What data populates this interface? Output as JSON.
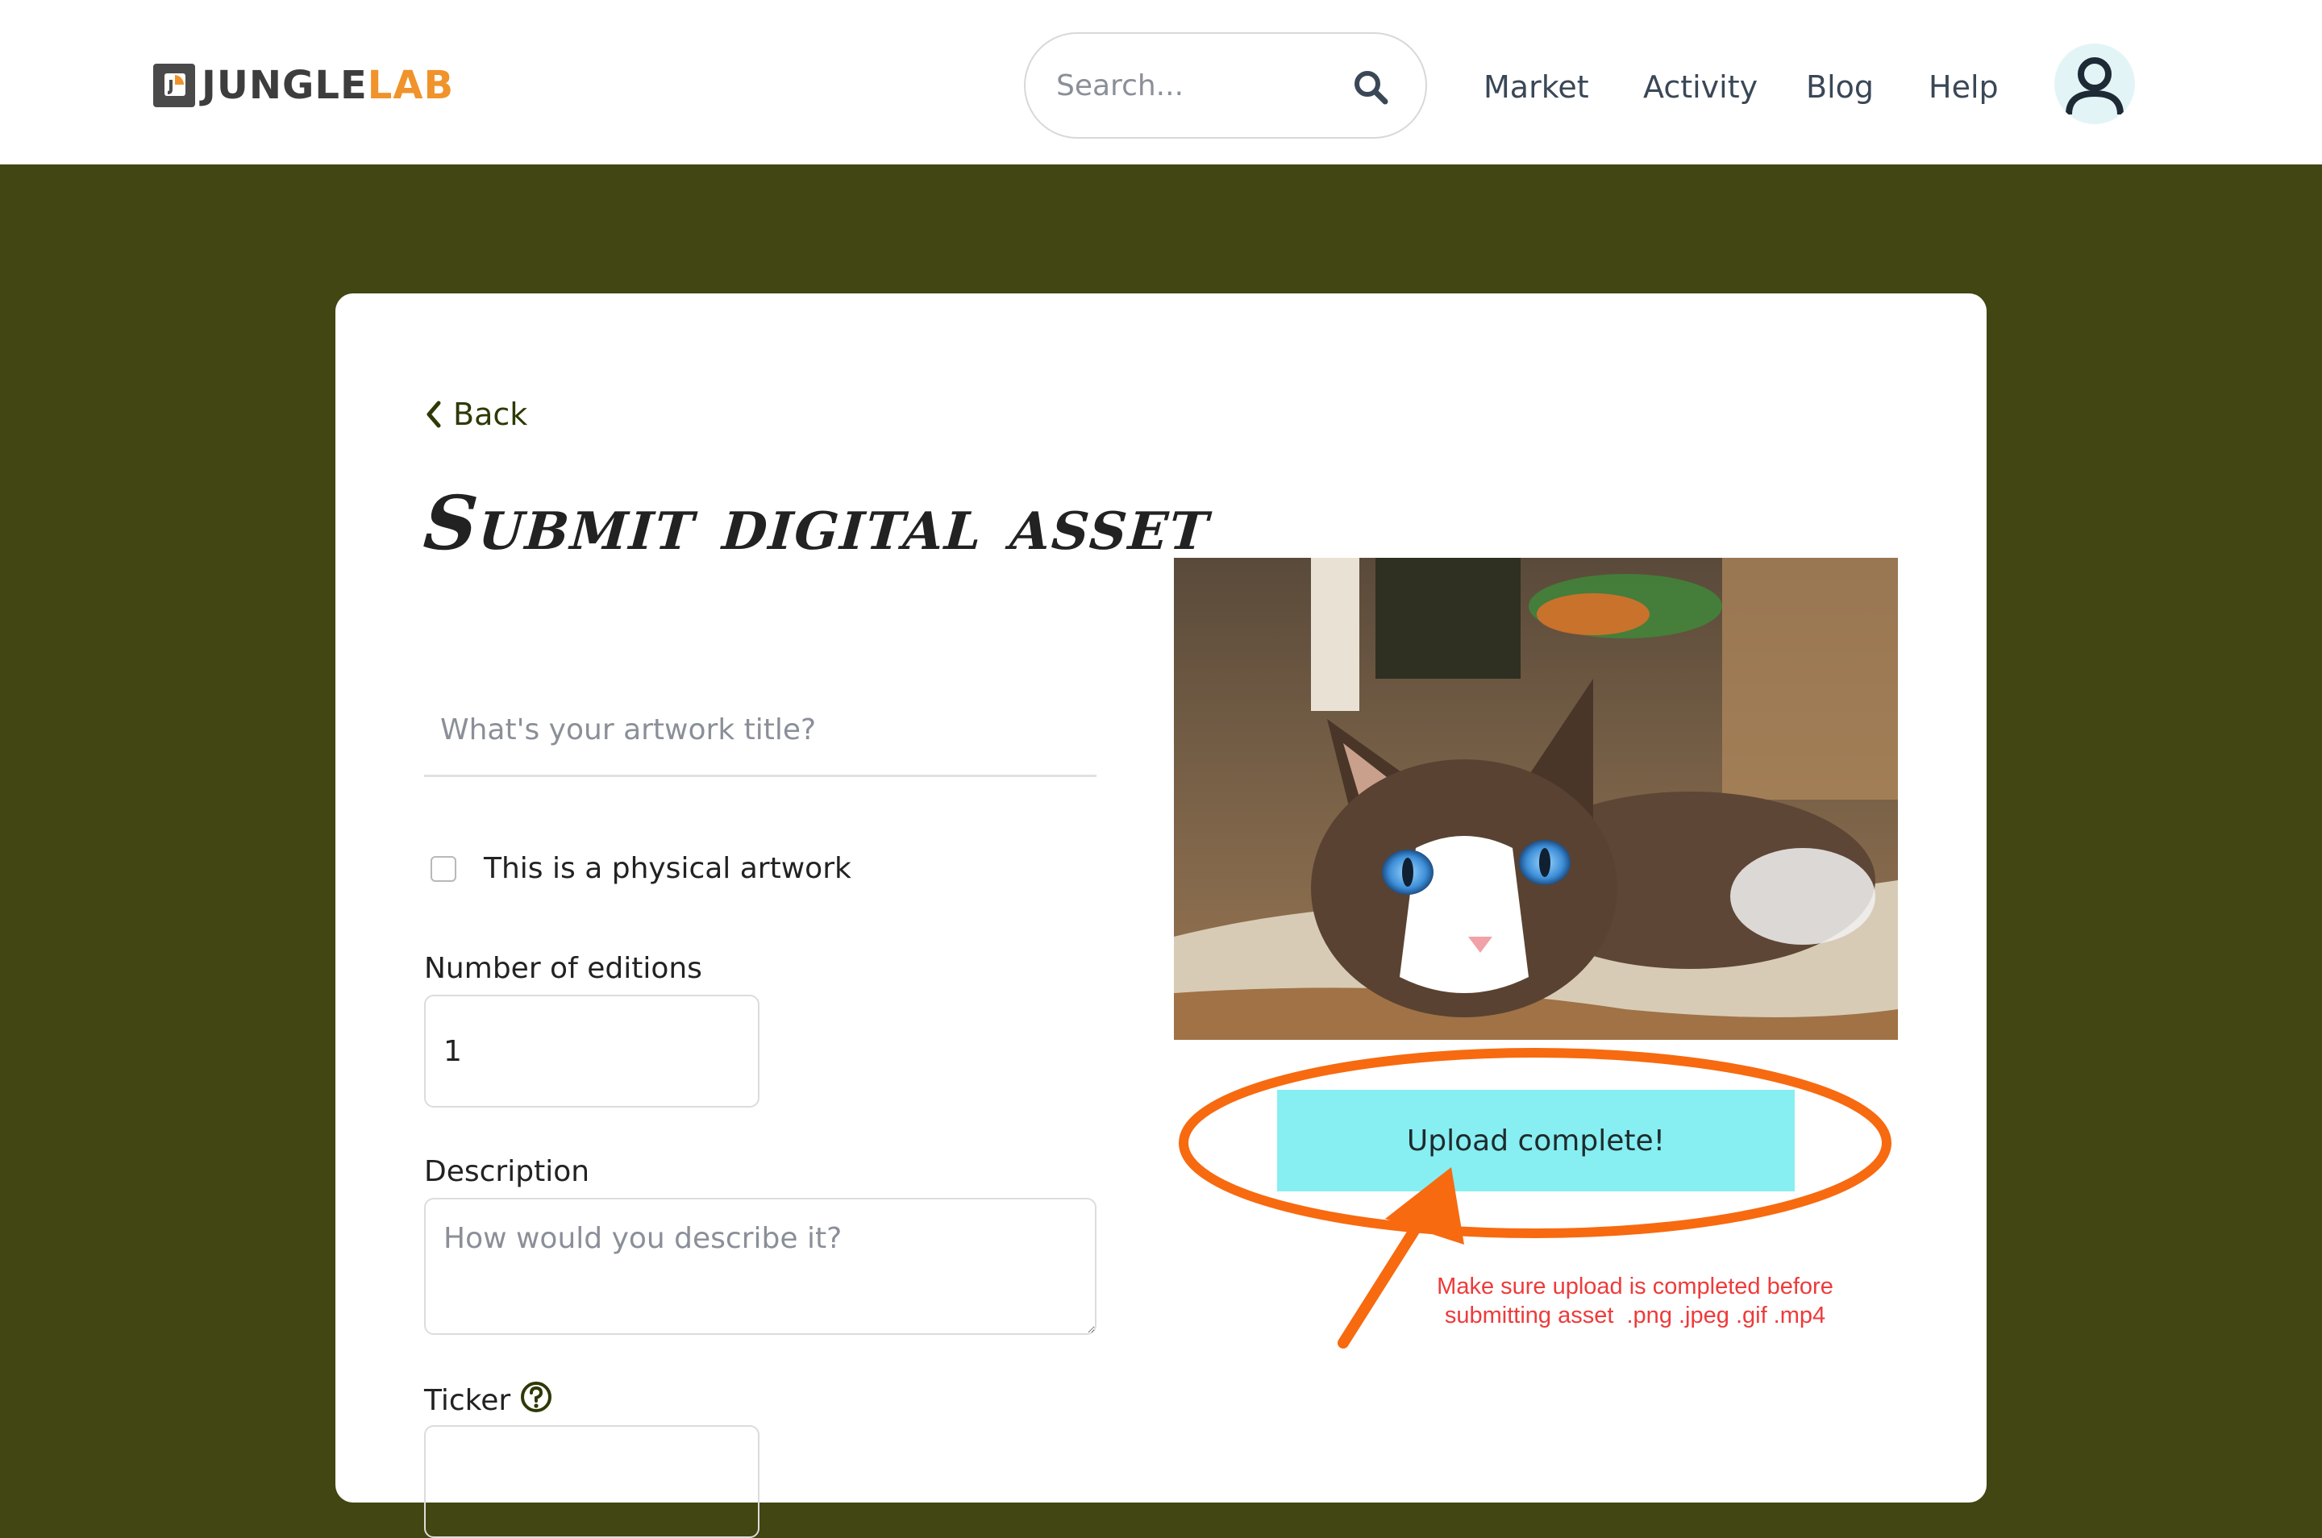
{
  "header": {
    "brand_primary": "JUNGLE",
    "brand_accent": "LAB",
    "search": {
      "placeholder": "Search..."
    },
    "nav": [
      "Market",
      "Activity",
      "Blog",
      "Help"
    ]
  },
  "form": {
    "back_label": "Back",
    "title": "Submit digital asset",
    "artwork_title": {
      "placeholder": "What's your artwork title?",
      "value": ""
    },
    "physical_artwork": {
      "label": "This is a physical artwork",
      "checked": false
    },
    "editions": {
      "label": "Number of editions",
      "value": "1"
    },
    "description": {
      "label": "Description",
      "placeholder": "How would you describe it?"
    },
    "ticker": {
      "label": "Ticker"
    }
  },
  "upload": {
    "status": "Upload complete!",
    "note_line1": "Make sure upload is completed before",
    "note_line2": "submitting asset  .png .jpeg .gif .mp4"
  },
  "colors": {
    "page_background": "#424612",
    "brand_orange": "#f0932b",
    "upload_status_bg": "#87eef2",
    "annotation": "#f76a10",
    "note_text": "#ee3a3a"
  },
  "icons": [
    "logo-mark-icon",
    "search-icon",
    "user-icon",
    "chevron-left-icon",
    "help-circle-icon"
  ]
}
